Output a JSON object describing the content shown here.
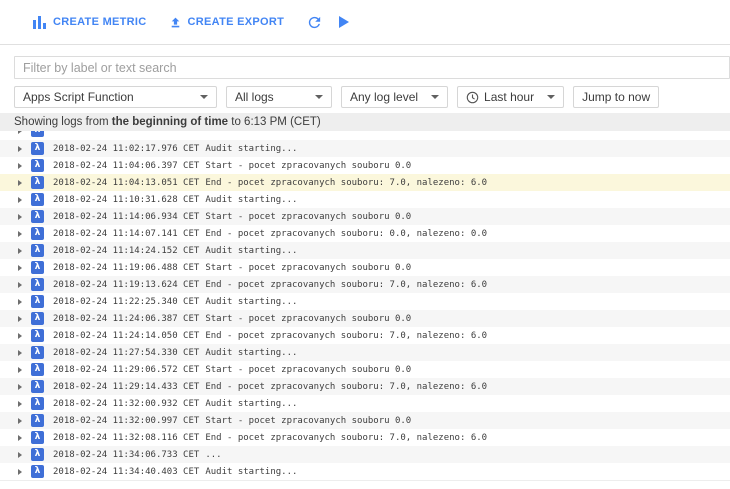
{
  "toolbar": {
    "create_metric_label": "CREATE METRIC",
    "create_export_label": "CREATE EXPORT"
  },
  "filter": {
    "placeholder": "Filter by label or text search"
  },
  "controls": {
    "function_select": "Apps Script Function",
    "logs_select": "All logs",
    "level_select": "Any log level",
    "time_select": "Last hour",
    "jump_button": "Jump to now"
  },
  "status_bar": {
    "prefix": "Showing logs from ",
    "bold": "the beginning of time",
    "suffix": " to 6:13 PM (CET)"
  },
  "icons": {
    "lambda_glyph": "λ"
  },
  "colors": {
    "accent_blue": "#4285f4",
    "lambda_icon_blue": "#3f6fd7",
    "row_stripe": "#f6f6f6",
    "row_highlight_yellow": "#fbf7dc",
    "status_bar_gray": "#eeeeee"
  },
  "logs": {
    "rows": [
      {
        "timestamp": "2018-02-24 11:02:17.976 CET",
        "message": "Audit starting...",
        "highlighted": false
      },
      {
        "timestamp": "2018-02-24 11:04:06.397 CET",
        "message": "Start - pocet zpracovanych souboru 0.0",
        "highlighted": false
      },
      {
        "timestamp": "2018-02-24 11:04:13.051 CET",
        "message": "End - pocet zpracovanych souboru: 7.0, nalezeno: 6.0",
        "highlighted": true
      },
      {
        "timestamp": "2018-02-24 11:10:31.628 CET",
        "message": "Audit starting...",
        "highlighted": false
      },
      {
        "timestamp": "2018-02-24 11:14:06.934 CET",
        "message": "Start - pocet zpracovanych souboru 0.0",
        "highlighted": false
      },
      {
        "timestamp": "2018-02-24 11:14:07.141 CET",
        "message": "End - pocet zpracovanych souboru: 0.0, nalezeno: 0.0",
        "highlighted": false
      },
      {
        "timestamp": "2018-02-24 11:14:24.152 CET",
        "message": "Audit starting...",
        "highlighted": false
      },
      {
        "timestamp": "2018-02-24 11:19:06.488 CET",
        "message": "Start - pocet zpracovanych souboru 0.0",
        "highlighted": false
      },
      {
        "timestamp": "2018-02-24 11:19:13.624 CET",
        "message": "End - pocet zpracovanych souboru: 7.0, nalezeno: 6.0",
        "highlighted": false
      },
      {
        "timestamp": "2018-02-24 11:22:25.340 CET",
        "message": "Audit starting...",
        "highlighted": false
      },
      {
        "timestamp": "2018-02-24 11:24:06.387 CET",
        "message": "Start - pocet zpracovanych souboru 0.0",
        "highlighted": false
      },
      {
        "timestamp": "2018-02-24 11:24:14.050 CET",
        "message": "End - pocet zpracovanych souboru: 7.0, nalezeno: 6.0",
        "highlighted": false
      },
      {
        "timestamp": "2018-02-24 11:27:54.330 CET",
        "message": "Audit starting...",
        "highlighted": false
      },
      {
        "timestamp": "2018-02-24 11:29:06.572 CET",
        "message": "Start - pocet zpracovanych souboru 0.0",
        "highlighted": false
      },
      {
        "timestamp": "2018-02-24 11:29:14.433 CET",
        "message": "End - pocet zpracovanych souboru: 7.0, nalezeno: 6.0",
        "highlighted": false
      },
      {
        "timestamp": "2018-02-24 11:32:00.932 CET",
        "message": "Audit starting...",
        "highlighted": false
      },
      {
        "timestamp": "2018-02-24 11:32:00.997 CET",
        "message": "Start - pocet zpracovanych souboru 0.0",
        "highlighted": false
      },
      {
        "timestamp": "2018-02-24 11:32:08.116 CET",
        "message": "End - pocet zpracovanych souboru: 7.0, nalezeno: 6.0",
        "highlighted": false
      },
      {
        "timestamp": "2018-02-24 11:34:06.733 CET",
        "message": "...",
        "highlighted": false
      },
      {
        "timestamp": "2018-02-24 11:34:40.403 CET",
        "message": "Audit starting...",
        "highlighted": false
      }
    ]
  }
}
